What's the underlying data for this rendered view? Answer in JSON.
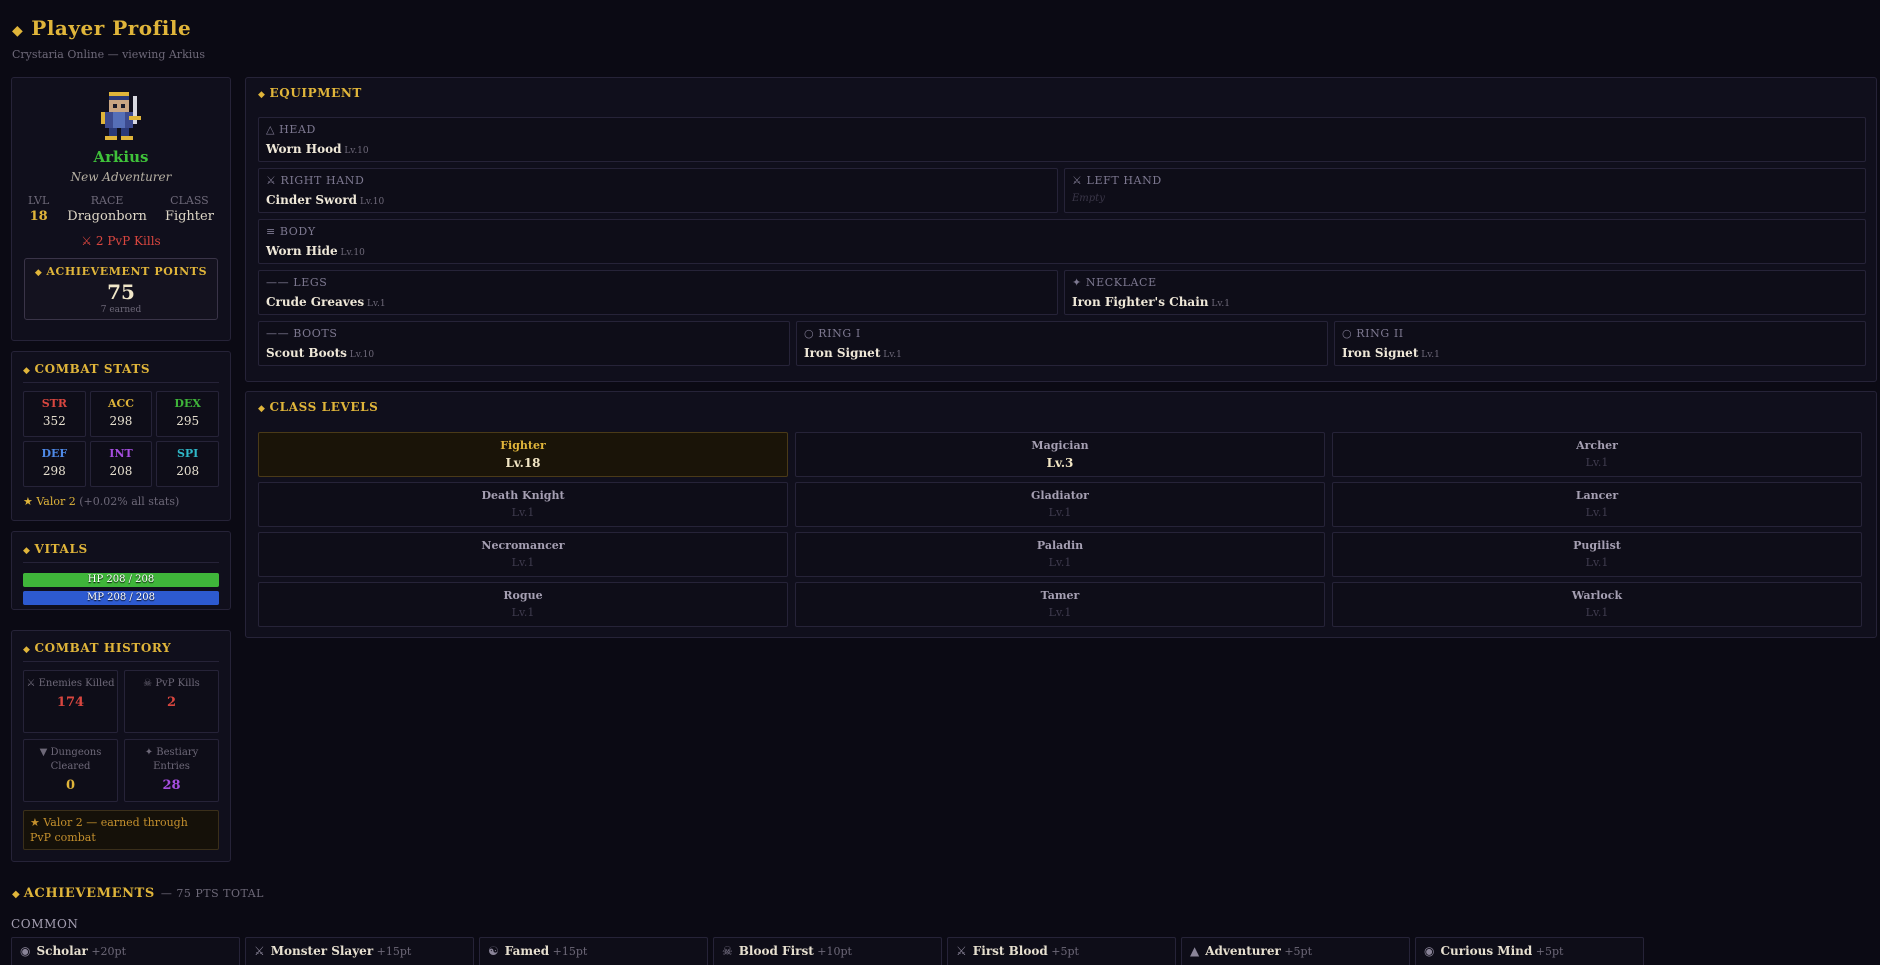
{
  "header": {
    "title": "Player Profile",
    "subtitle": "Crystaria Online — viewing Arkius"
  },
  "profile": {
    "name": "Arkius",
    "title": "New Adventurer",
    "level_label": "LVL",
    "level": "18",
    "race_label": "RACE",
    "race": "Dragonborn",
    "class_label": "CLASS",
    "class": "Fighter",
    "pvp": "⚔ 2 PvP Kills",
    "achievement_label": "ACHIEVEMENT POINTS",
    "achievement_points": "75",
    "achievement_earned": "7 earned"
  },
  "combat_stats": {
    "title": "COMBAT STATS",
    "stats": [
      {
        "key": "STR",
        "value": "352",
        "color": "#d9463f"
      },
      {
        "key": "ACC",
        "value": "298",
        "color": "#e0b53a"
      },
      {
        "key": "DEX",
        "value": "295",
        "color": "#3fb53a"
      },
      {
        "key": "DEF",
        "value": "298",
        "color": "#4f8ae8"
      },
      {
        "key": "INT",
        "value": "208",
        "color": "#a64ee0"
      },
      {
        "key": "SPI",
        "value": "208",
        "color": "#2fb8c8"
      }
    ],
    "valor": "★ Valor 2",
    "valor_bonus": "(+0.02% all stats)"
  },
  "vitals": {
    "title": "VITALS",
    "hp": "HP 208 / 208",
    "hp_fraction": 1.0,
    "mp": "MP 208 / 208",
    "mp_fraction": 1.0
  },
  "combat_history": {
    "title": "COMBAT HISTORY",
    "cells": [
      {
        "icon": "⚔",
        "label": "Enemies Killed",
        "value": "174",
        "color": "#d9463f"
      },
      {
        "icon": "☠",
        "label": "PvP Kills",
        "value": "2",
        "color": "#d9463f"
      },
      {
        "icon": "▼",
        "label": "Dungeons Cleared",
        "value": "0",
        "color": "#e0b53a"
      },
      {
        "icon": "✦",
        "label": "Bestiary Entries",
        "value": "28",
        "color": "#a64ee0"
      }
    ],
    "note": "★ Valor 2 — earned through PvP combat"
  },
  "equipment": {
    "title": "EQUIPMENT",
    "slots": [
      {
        "icon": "△",
        "label": "HEAD",
        "item": "Worn Hood",
        "level": "Lv.10"
      },
      {
        "icon": "⚔",
        "label": "RIGHT HAND",
        "item": "Cinder Sword",
        "level": "Lv.10"
      },
      {
        "icon": "⚔",
        "label": "LEFT HAND",
        "item": "",
        "level": "",
        "empty": "Empty"
      },
      {
        "icon": "≡",
        "label": "BODY",
        "item": "Worn Hide",
        "level": "Lv.10"
      },
      {
        "icon": "——",
        "label": "LEGS",
        "item": "Crude Greaves",
        "level": "Lv.1"
      },
      {
        "icon": "✦",
        "label": "NECKLACE",
        "item": "Iron Fighter's Chain",
        "level": "Lv.1"
      },
      {
        "icon": "——",
        "label": "BOOTS",
        "item": "Scout Boots",
        "level": "Lv.10"
      },
      {
        "icon": "○",
        "label": "RING I",
        "item": "Iron Signet",
        "level": "Lv.1"
      },
      {
        "icon": "○",
        "label": "RING II",
        "item": "Iron Signet",
        "level": "Lv.1"
      }
    ]
  },
  "class_levels": {
    "title": "CLASS LEVELS",
    "classes": [
      {
        "name": "Fighter",
        "level": "Lv.18"
      },
      {
        "name": "Magician",
        "level": "Lv.3"
      },
      {
        "name": "Archer",
        "level": "Lv.1"
      },
      {
        "name": "Death Knight",
        "level": "Lv.1"
      },
      {
        "name": "Gladiator",
        "level": "Lv.1"
      },
      {
        "name": "Lancer",
        "level": "Lv.1"
      },
      {
        "name": "Necromancer",
        "level": "Lv.1"
      },
      {
        "name": "Paladin",
        "level": "Lv.1"
      },
      {
        "name": "Pugilist",
        "level": "Lv.1"
      },
      {
        "name": "Rogue",
        "level": "Lv.1"
      },
      {
        "name": "Tamer",
        "level": "Lv.1"
      },
      {
        "name": "Warlock",
        "level": "Lv.1"
      }
    ]
  },
  "achievements": {
    "title": "ACHIEVEMENTS",
    "total": "— 75 PTS TOTAL",
    "group": "COMMON",
    "items": [
      {
        "icon": "◉",
        "name": "Scholar",
        "points": "+20pt"
      },
      {
        "icon": "⚔",
        "name": "Monster Slayer",
        "points": "+15pt"
      },
      {
        "icon": "☯",
        "name": "Famed",
        "points": "+15pt"
      },
      {
        "icon": "☠",
        "name": "Blood First",
        "points": "+10pt"
      },
      {
        "icon": "⚔",
        "name": "First Blood",
        "points": "+5pt"
      },
      {
        "icon": "▲",
        "name": "Adventurer",
        "points": "+5pt"
      },
      {
        "icon": "◉",
        "name": "Curious Mind",
        "points": "+5pt"
      }
    ]
  }
}
